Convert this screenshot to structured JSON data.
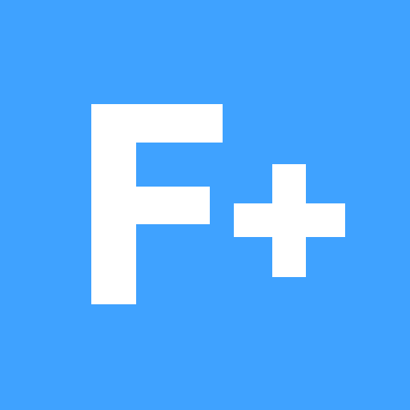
{
  "icon": {
    "logo_text": "F+",
    "icon_name": "f-plus-logo",
    "background_color": "#3fa2ff",
    "glyph_color": "#ffffff"
  }
}
